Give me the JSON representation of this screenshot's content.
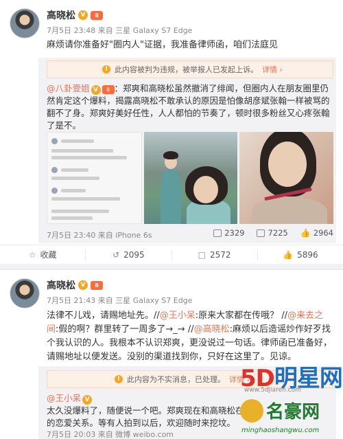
{
  "post1": {
    "author": "高晓松",
    "verified_badge": "V",
    "vip_badge": "8",
    "meta": "7月5日 23:48 来自 三星 Galaxy S7 Edge",
    "text": "麻烦请你准备好\"圈内人\"证据，我准备律师函，咱们法庭见",
    "notice": {
      "icon": "warning-icon",
      "text": "此内容被判为违规，被举报人已发起上诉。",
      "link": "详情 ›"
    },
    "repost": {
      "author": "@八卦壹姐",
      "verified_badge": "V",
      "vip_badge": "8",
      "text": "：郑爽和高晓松虽然撤消了绯闻，但圈内人在朋友圈里仍然肯定这个爆料，揭露高晓松不敢承认的原因是怕像胡彦斌张翰一样被骂的翻不了身。郑爽好美好任性，人人都怕的节奏了，顿时很多粉丝又心疼张翰了是不。",
      "meta": "7月5日 23:40 来自 iPhone 6s",
      "stats": {
        "repost": "2329",
        "comment": "7225",
        "like": "2964"
      },
      "images": [
        "chat-screenshot",
        "costume-photo",
        "portrait-photo"
      ]
    },
    "actions": [
      {
        "icon": "star-icon",
        "label": "收藏"
      },
      {
        "icon": "repost-icon",
        "label": "2095"
      },
      {
        "icon": "comment-icon",
        "label": "2572"
      },
      {
        "icon": "like-icon",
        "label": "5896"
      }
    ]
  },
  "post2": {
    "author": "高晓松",
    "verified_badge": "V",
    "vip_badge": "8",
    "meta": "7月5日 21:43 来自 三星 Galaxy S7 Edge",
    "text_parts": {
      "a": "法律不儿戏，请赐地址先。//",
      "m1": "@王小呆",
      "b": ":原来大家都在传哦？ //",
      "m2": "@来去之间",
      "c": ":假的啊？群里转了一周多了→_→ //",
      "m3": "@高晓松",
      "d": ":麻烦以后造谣炒作好歹找个我认识的人。我根本不认识郑爽，更没说过一句话。律师函已准备好，请赐地址以便发送。没别的渠道找到你，只好在这里了。见谅。"
    },
    "notice": {
      "icon": "warning-icon",
      "text": "此内容为不实消息，已处理。",
      "link": "详情 ›"
    },
    "repost": {
      "author": "@王小呆",
      "verified_badge": "V",
      "text": "太久没爆料了，随便说一个吧。郑爽现在和高晓松在",
      "text_line2": "的恋爱关系。等有人拍到以后，欢迎随时来挖坟。",
      "meta": "7月5日 20:03 来自 微博 weibo.com"
    }
  },
  "watermarks": {
    "site1_a": "5D",
    "site1_b": "明星网",
    "site1_url": "www.5djiaren.com",
    "site2_name": "名豪网",
    "site2_url": "minghaoshangwu.com"
  }
}
